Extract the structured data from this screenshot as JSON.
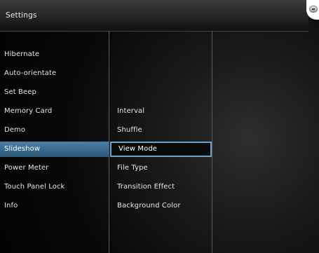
{
  "header": {
    "title": "Settings"
  },
  "left_menu": {
    "items": [
      {
        "label": "Hibernate"
      },
      {
        "label": "Auto-orientate"
      },
      {
        "label": "Set Beep"
      },
      {
        "label": "Memory Card"
      },
      {
        "label": "Demo"
      },
      {
        "label": "Slideshow"
      },
      {
        "label": "Power Meter"
      },
      {
        "label": "Touch Panel Lock"
      },
      {
        "label": "Info"
      }
    ],
    "selected": "Slideshow"
  },
  "slideshow_menu": {
    "items": [
      {
        "label": "Interval"
      },
      {
        "label": "Shuffle"
      },
      {
        "label": "View Mode"
      },
      {
        "label": "File Type"
      },
      {
        "label": "Transition Effect"
      },
      {
        "label": "Background Color"
      }
    ],
    "focused": "View Mode"
  },
  "icons": {
    "top_right": "power-icon"
  },
  "colors": {
    "selection": "#3a6d92",
    "focus_border": "#6aa3cc",
    "background": "#0a0a0a"
  }
}
